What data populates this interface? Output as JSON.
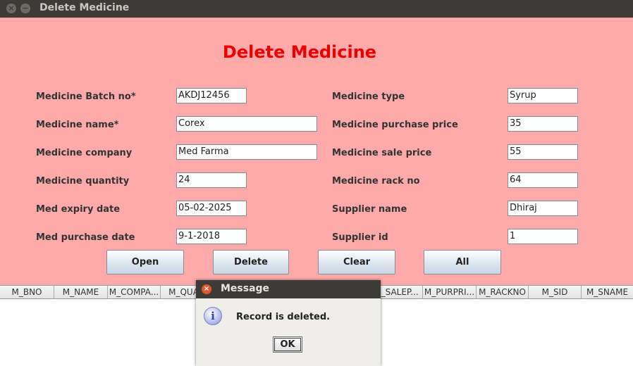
{
  "window": {
    "title": "Delete Medicine",
    "close_glyph": "×",
    "minimize_glyph": "−"
  },
  "form": {
    "heading": "Delete Medicine",
    "left": [
      {
        "label": "Medicine Batch no*",
        "value": "AKDJ12456"
      },
      {
        "label": "Medicine name*",
        "value": "Corex"
      },
      {
        "label": "Medicine company",
        "value": "Med Farma"
      },
      {
        "label": "Medicine quantity",
        "value": "24"
      },
      {
        "label": "Med expiry date",
        "value": "05-02-2025"
      },
      {
        "label": "Med purchase date",
        "value": "9-1-2018"
      }
    ],
    "right": [
      {
        "label": "Medicine type",
        "value": "Syrup"
      },
      {
        "label": "Medicine purchase price",
        "value": "35"
      },
      {
        "label": "Medicine sale price",
        "value": "55"
      },
      {
        "label": "Medicine rack no",
        "value": "64"
      },
      {
        "label": "Supplier name",
        "value": "Dhiraj"
      },
      {
        "label": "Supplier id",
        "value": "1"
      }
    ]
  },
  "buttons": {
    "open": "Open",
    "delete": "Delete",
    "clear": "Clear",
    "all": "All"
  },
  "table": {
    "columns": [
      "M_BNO",
      "M_NAME",
      "M_COMPA...",
      "M_QUAN",
      "",
      "",
      "M_SALEP...",
      "M_PURPRI...",
      "M_RACKNO",
      "M_SID",
      "M_SNAME"
    ]
  },
  "dialog": {
    "title": "Message",
    "message": "Record is deleted.",
    "ok": "OK",
    "icon": "info-icon",
    "icon_glyph": "i",
    "close_glyph": "×"
  },
  "colors": {
    "background": "#ffaaaa",
    "heading": "#ee0000",
    "titlebar": "#3c3b37"
  }
}
